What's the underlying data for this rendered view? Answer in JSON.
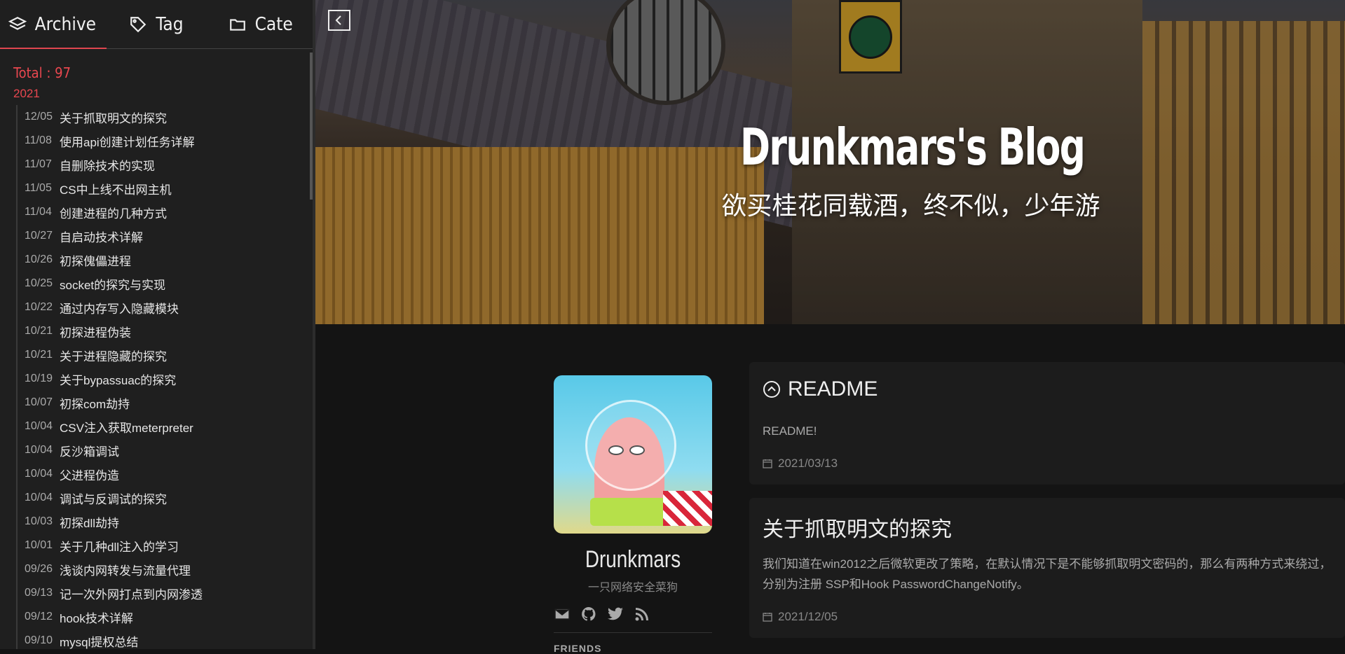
{
  "sidebar": {
    "tabs": [
      {
        "label": "Archive",
        "icon": "layers-icon"
      },
      {
        "label": "Tag",
        "icon": "tag-icon"
      },
      {
        "label": "Cate",
        "icon": "folder-icon"
      }
    ],
    "total": "Total : 97",
    "year": "2021",
    "posts": [
      {
        "date": "12/05",
        "title": "关于抓取明文的探究"
      },
      {
        "date": "11/08",
        "title": "使用api创建计划任务详解"
      },
      {
        "date": "11/07",
        "title": "自删除技术的实现"
      },
      {
        "date": "11/05",
        "title": "CS中上线不出网主机"
      },
      {
        "date": "11/04",
        "title": "创建进程的几种方式"
      },
      {
        "date": "10/27",
        "title": "自启动技术详解"
      },
      {
        "date": "10/26",
        "title": "初探傀儡进程"
      },
      {
        "date": "10/25",
        "title": "socket的探究与实现"
      },
      {
        "date": "10/22",
        "title": "通过内存写入隐藏模块"
      },
      {
        "date": "10/21",
        "title": "初探进程伪装"
      },
      {
        "date": "10/21",
        "title": "关于进程隐藏的探究"
      },
      {
        "date": "10/19",
        "title": "关于bypassuac的探究"
      },
      {
        "date": "10/07",
        "title": "初探com劫持"
      },
      {
        "date": "10/04",
        "title": "CSV注入获取meterpreter"
      },
      {
        "date": "10/04",
        "title": "反沙箱调试"
      },
      {
        "date": "10/04",
        "title": "父进程伪造"
      },
      {
        "date": "10/04",
        "title": "调试与反调试的探究"
      },
      {
        "date": "10/03",
        "title": "初探dll劫持"
      },
      {
        "date": "10/01",
        "title": "关于几种dll注入的学习"
      },
      {
        "date": "09/26",
        "title": "浅谈内网转发与流量代理"
      },
      {
        "date": "09/13",
        "title": "记一次外网打点到内网渗透"
      },
      {
        "date": "09/12",
        "title": "hook技术详解"
      },
      {
        "date": "09/10",
        "title": "mysql提权总结"
      }
    ]
  },
  "hero": {
    "title": "Drunkmars's Blog",
    "subtitle": "欲买桂花同载酒，终不似，少年游"
  },
  "profile": {
    "name": "Drunkmars",
    "description": "一只网络安全菜狗",
    "friends_label": "FRIENDS"
  },
  "cards": [
    {
      "title": "README",
      "body": "README!",
      "date": "2021/03/13"
    },
    {
      "title": "关于抓取明文的探究",
      "body": "我们知道在win2012之后微软更改了策略，在默认情况下是不能够抓取明文密码的，那么有两种方式来绕过，分别为注册 SSP和Hook PasswordChangeNotify。",
      "date": "2021/12/05"
    }
  ],
  "colors": {
    "accent": "#e8474f",
    "background": "#141414",
    "sidebar": "#1f1f1f"
  }
}
